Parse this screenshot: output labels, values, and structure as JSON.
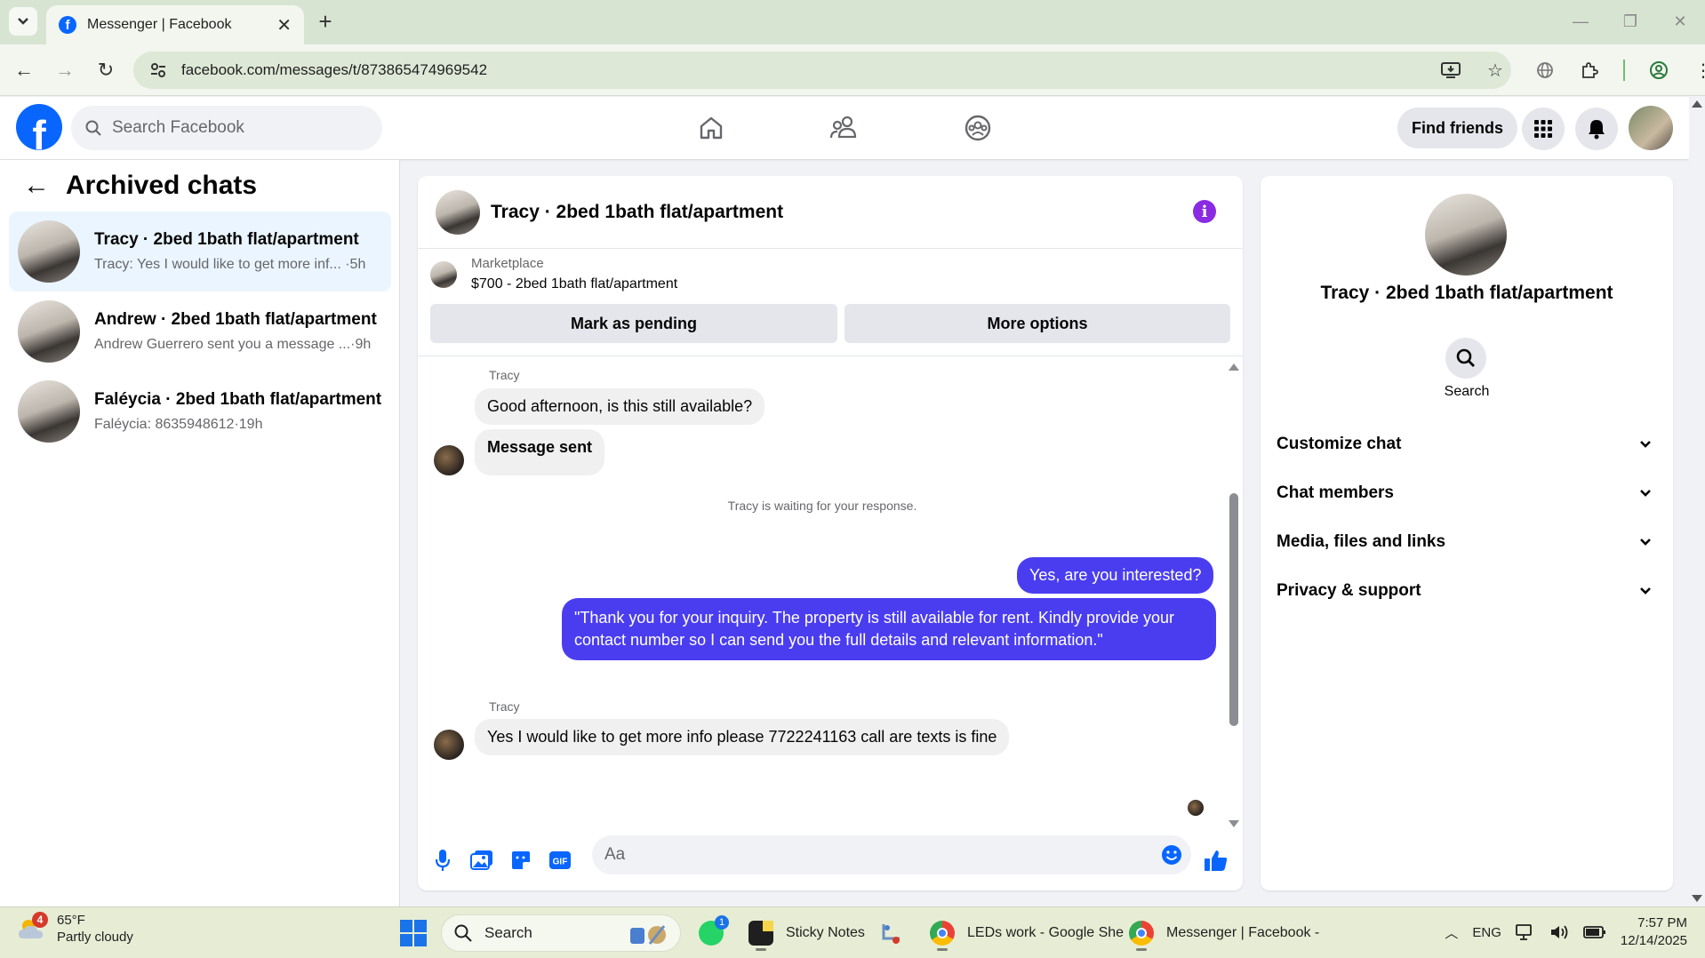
{
  "browser": {
    "tab_title": "Messenger | Facebook",
    "url": "facebook.com/messages/t/873865474969542"
  },
  "header": {
    "search_placeholder": "Search Facebook",
    "find_friends_label": "Find friends"
  },
  "sidebar": {
    "title": "Archived chats",
    "chats": [
      {
        "name": "Tracy · 2bed 1bath flat/apartment",
        "snippet": "Tracy: Yes I would like to get more inf...",
        "time": "·5h",
        "active": true
      },
      {
        "name": "Andrew · 2bed 1bath flat/apartment",
        "snippet": "Andrew Guerrero sent you a message ...",
        "time": "·9h",
        "active": false
      },
      {
        "name": "Faléycia · 2bed 1bath flat/apartment",
        "snippet": "Faléycia: 8635948612",
        "time": "·19h",
        "active": false
      }
    ]
  },
  "conversation": {
    "title": "Tracy · 2bed 1bath flat/apartment",
    "marketplace_label": "Marketplace",
    "listing": "$700 - 2bed 1bath flat/apartment",
    "mark_pending_label": "Mark as pending",
    "more_options_label": "More options",
    "messages": {
      "sender1": "Tracy",
      "msg1": "Good afternoon, is this still available?",
      "msg2": "Message sent",
      "system_note": "Tracy is waiting for your response.",
      "out1": "Yes, are you interested?",
      "out2": "\"Thank you for your inquiry. The property is still available for rent. Kindly provide your contact number so I can send you the full details and relevant information.\"",
      "sender2": "Tracy",
      "msg3": "Yes I would like to get more info please 7722241163 call are texts is fine"
    },
    "composer_placeholder": "Aa"
  },
  "details": {
    "name": "Tracy · 2bed 1bath flat/apartment",
    "search_label": "Search",
    "sections": [
      "Customize chat",
      "Chat members",
      "Media, files and links",
      "Privacy & support"
    ]
  },
  "taskbar": {
    "weather_temp": "65°F",
    "weather_desc": "Partly cloudy",
    "weather_badge": "4",
    "search_label": "Search",
    "whatsapp_badge": "1",
    "apps": [
      "Sticky Notes",
      "LEDs work - Google She",
      "Messenger | Facebook -"
    ],
    "lang": "ENG",
    "time": "7:57 PM",
    "date": "12/14/2025"
  },
  "colors": {
    "fb_blue": "#0866ff",
    "outgoing_bubble": "#4a3df0",
    "info_purple": "#8a2be2"
  }
}
